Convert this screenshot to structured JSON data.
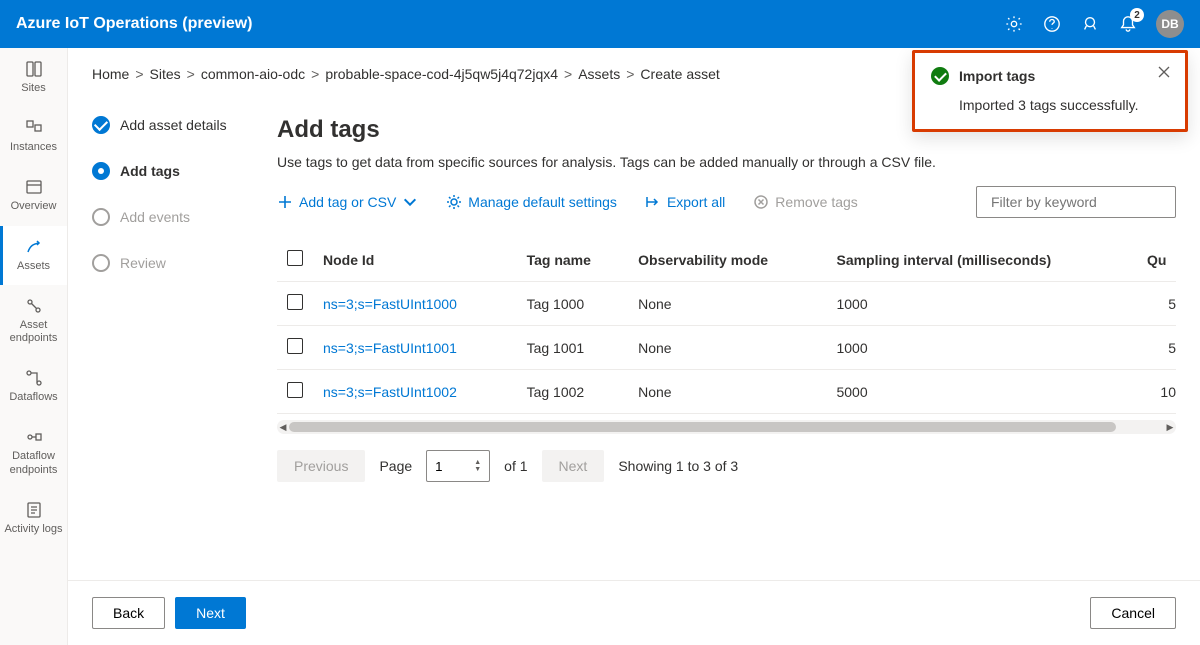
{
  "header": {
    "title": "Azure IoT Operations (preview)",
    "notification_count": "2",
    "user_initials": "DB"
  },
  "leftnav": {
    "items": [
      {
        "label": "Sites",
        "icon": "book"
      },
      {
        "label": "Instances",
        "icon": "blocks"
      },
      {
        "label": "Overview",
        "icon": "panel"
      },
      {
        "label": "Assets",
        "icon": "asset"
      },
      {
        "label": "Asset endpoints",
        "icon": "link"
      },
      {
        "label": "Dataflows",
        "icon": "flow"
      },
      {
        "label": "Dataflow endpoints",
        "icon": "flowend"
      },
      {
        "label": "Activity logs",
        "icon": "logs"
      }
    ],
    "active_index": 3
  },
  "breadcrumb": {
    "items": [
      "Home",
      "Sites",
      "common-aio-odc",
      "probable-space-cod-4j5qw5j4q72jqx4",
      "Assets"
    ],
    "current": "Create asset"
  },
  "steps": {
    "items": [
      {
        "label": "Add asset details",
        "state": "done"
      },
      {
        "label": "Add tags",
        "state": "current"
      },
      {
        "label": "Add events",
        "state": "pending"
      },
      {
        "label": "Review",
        "state": "pending"
      }
    ]
  },
  "page": {
    "title": "Add tags",
    "description": "Use tags to get data from specific sources for analysis. Tags can be added manually or through a CSV file."
  },
  "toolbar": {
    "add": "Add tag or CSV",
    "manage": "Manage default settings",
    "exportall": "Export all",
    "remove": "Remove tags",
    "filter_placeholder": "Filter by keyword"
  },
  "table": {
    "columns": [
      "Node Id",
      "Tag name",
      "Observability mode",
      "Sampling interval (milliseconds)",
      "Qu"
    ],
    "rows": [
      {
        "node": "ns=3;s=FastUInt1000",
        "tag": "Tag 1000",
        "obs": "None",
        "interval": "1000",
        "qu": "5"
      },
      {
        "node": "ns=3;s=FastUInt1001",
        "tag": "Tag 1001",
        "obs": "None",
        "interval": "1000",
        "qu": "5"
      },
      {
        "node": "ns=3;s=FastUInt1002",
        "tag": "Tag 1002",
        "obs": "None",
        "interval": "5000",
        "qu": "10"
      }
    ]
  },
  "pager": {
    "previous": "Previous",
    "next": "Next",
    "page_label": "Page",
    "page_value": "1",
    "of_label": "of 1",
    "showing": "Showing 1 to 3 of 3"
  },
  "footer": {
    "back": "Back",
    "next": "Next",
    "cancel": "Cancel"
  },
  "toast": {
    "title": "Import tags",
    "message": "Imported 3 tags successfully."
  }
}
